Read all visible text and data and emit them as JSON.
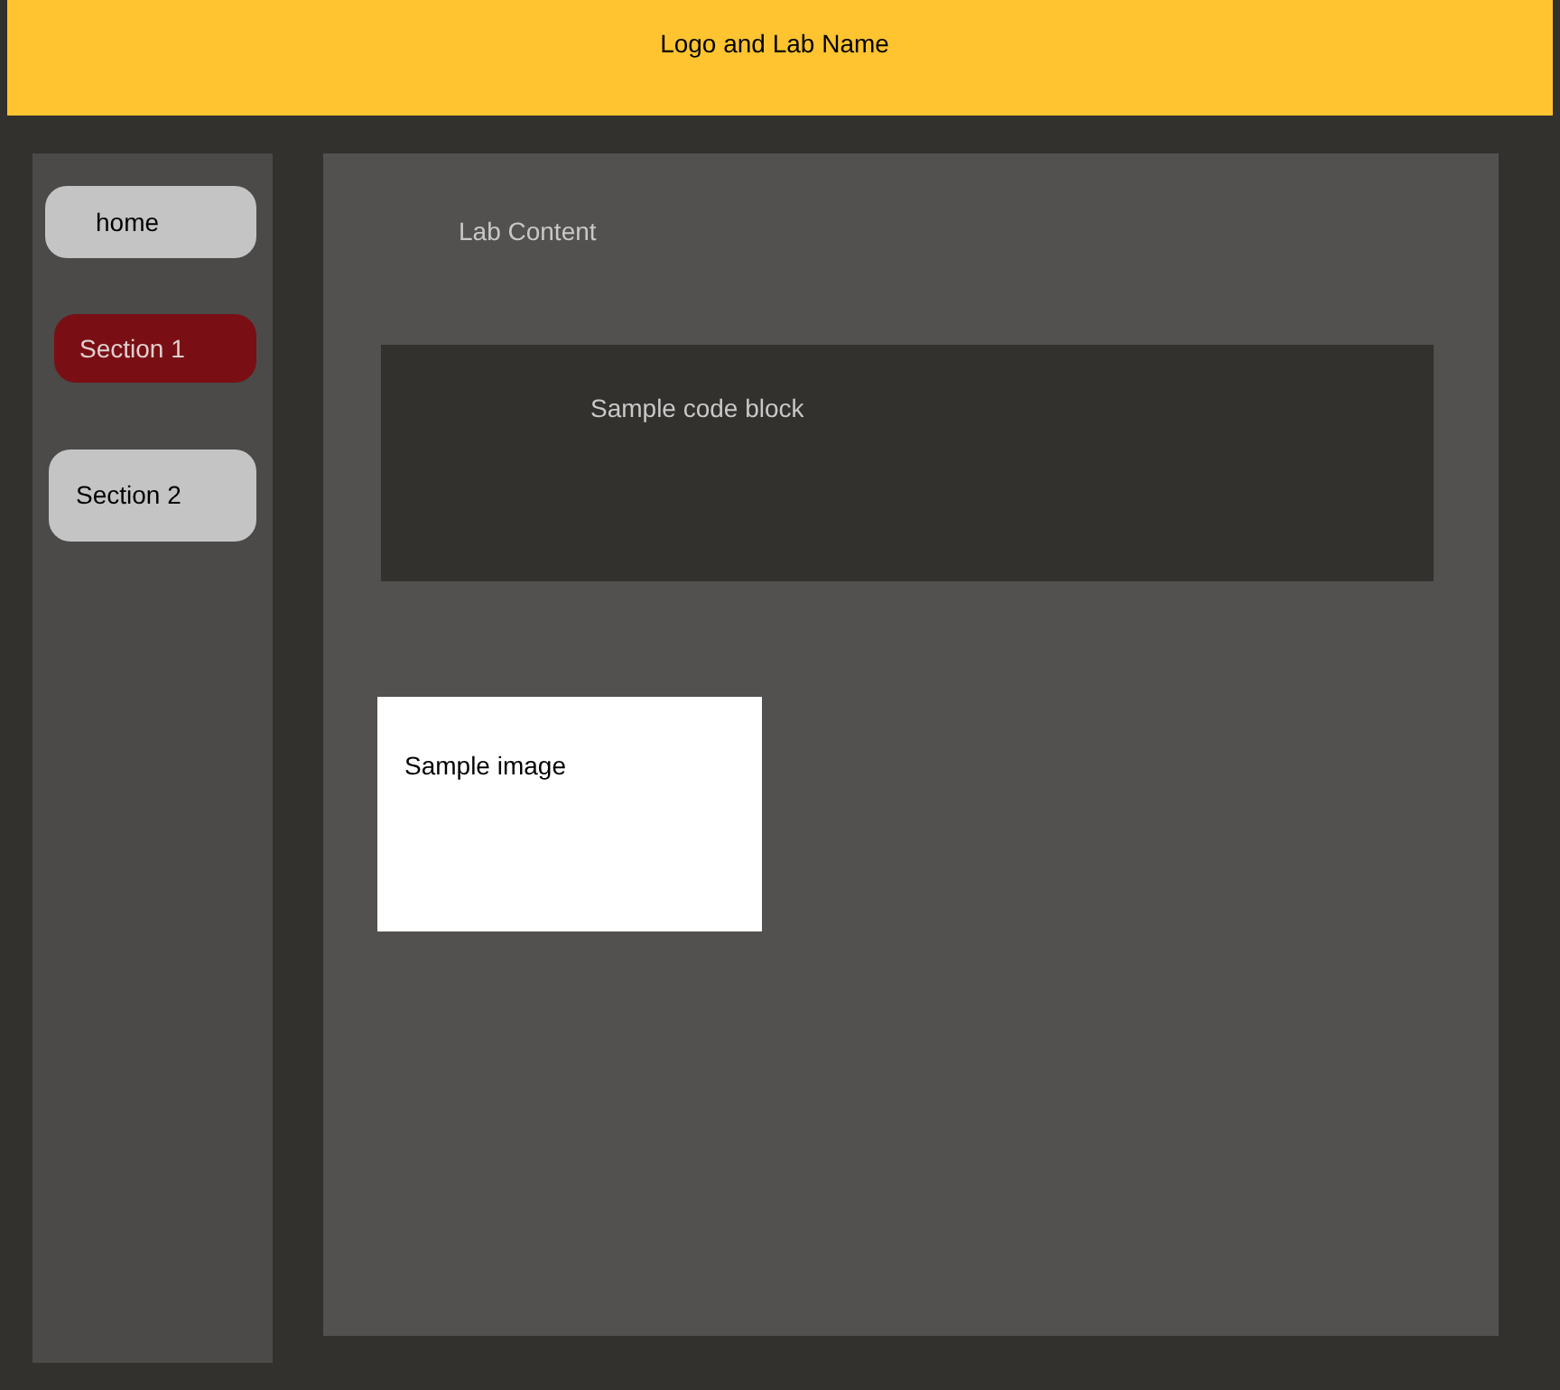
{
  "header": {
    "title": "Logo and Lab Name"
  },
  "nav": [
    {
      "label": "home",
      "selected": false
    },
    {
      "label": "Section 1",
      "selected": true
    },
    {
      "label": "Section 2",
      "selected": false
    }
  ],
  "content": {
    "heading": "Lab Content",
    "code_block": "Sample code block",
    "image": "Sample image"
  }
}
